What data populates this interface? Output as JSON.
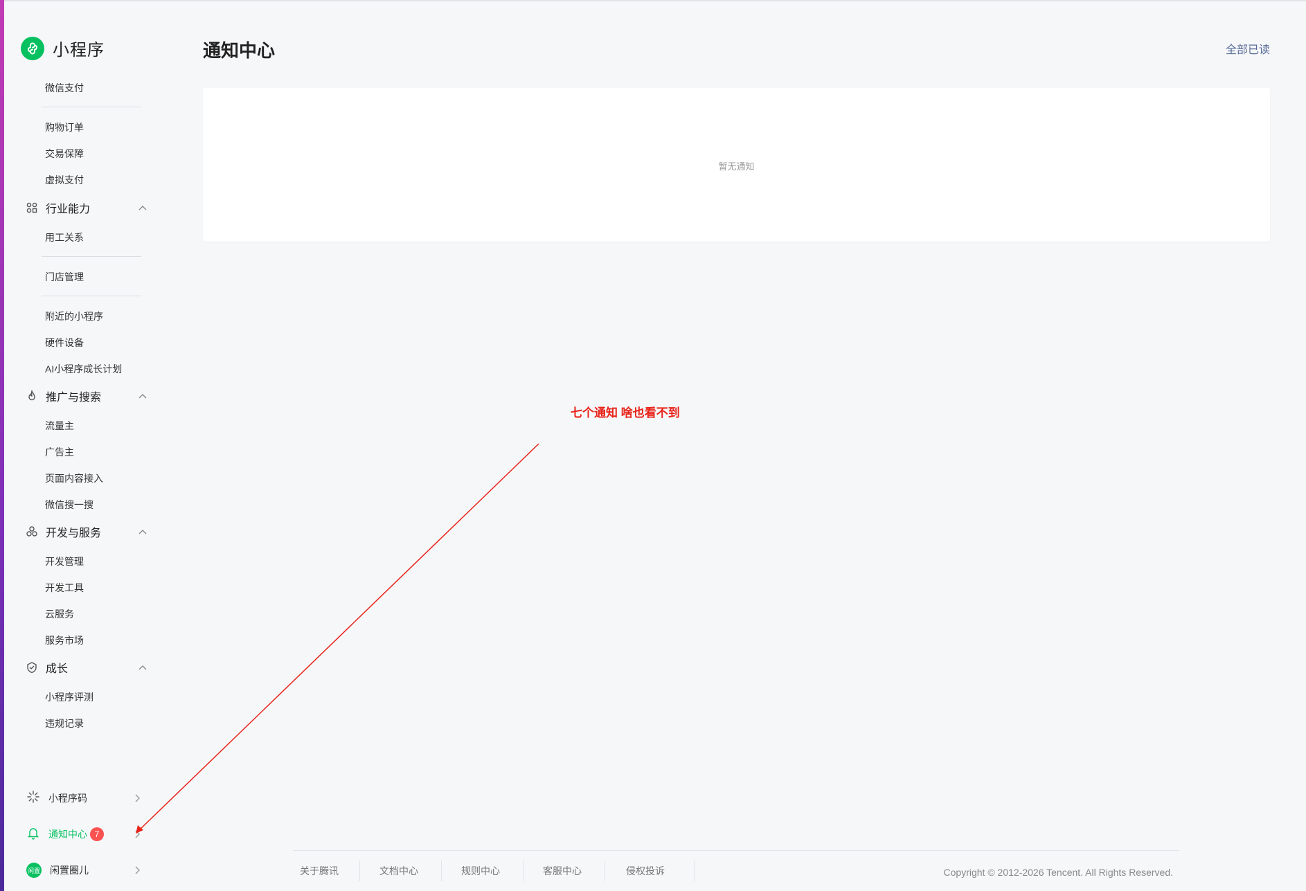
{
  "brand": {
    "title": "小程序"
  },
  "sidebar": {
    "top_items": [
      "微信支付",
      "购物订单",
      "交易保障",
      "虚拟支付"
    ],
    "groups": [
      {
        "label": "行业能力",
        "icon": "industry-icon",
        "items": [
          "用工关系",
          "门店管理",
          "附近的小程序",
          "硬件设备",
          "AI小程序成长计划"
        ]
      },
      {
        "label": "推广与搜索",
        "icon": "fire-icon",
        "items": [
          "流量主",
          "广告主",
          "页面内容接入",
          "微信搜一搜"
        ]
      },
      {
        "label": "开发与服务",
        "icon": "dev-services-icon",
        "items": [
          "开发管理",
          "开发工具",
          "云服务",
          "服务市场"
        ]
      },
      {
        "label": "成长",
        "icon": "growth-icon",
        "items": [
          "小程序评测",
          "违规记录"
        ]
      }
    ],
    "bottom": {
      "qrcode": {
        "label": "小程序码",
        "icon": "qrcode-sun-icon"
      },
      "notifications": {
        "label": "通知中心",
        "badge": "7",
        "icon": "bell-icon"
      },
      "account": {
        "label": "闲置圈儿",
        "avatar_text": "闲置"
      }
    }
  },
  "main": {
    "title": "通知中心",
    "mark_all_read": "全部已读",
    "empty_text": "暂无通知"
  },
  "annotation": {
    "text": "七个通知 啥也看不到",
    "color": "#e8231a"
  },
  "footer": {
    "links": [
      "关于腾讯",
      "文档中心",
      "规则中心",
      "客服中心",
      "侵权投诉"
    ],
    "copyright": "Copyright © 2012-2026 Tencent. All Rights Reserved."
  },
  "colors": {
    "accent": "#07c160",
    "badge": "#fa5151",
    "link": "#576b95"
  }
}
